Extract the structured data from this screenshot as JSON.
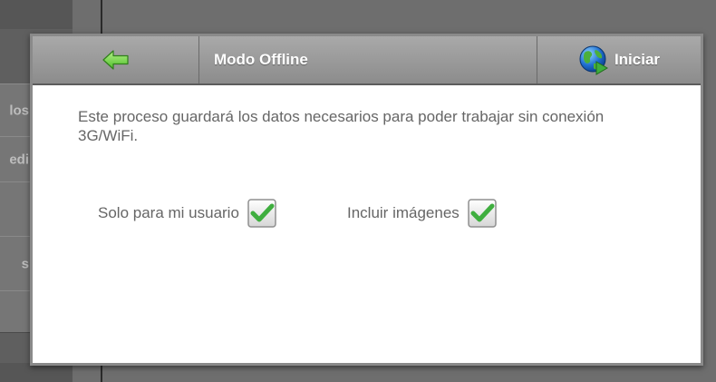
{
  "background": {
    "tabs": [
      {
        "label": "los"
      },
      {
        "label": "edi"
      },
      {
        "label": ""
      },
      {
        "label": "s"
      },
      {
        "label": ""
      }
    ]
  },
  "dialog": {
    "title": "Modo Offline",
    "back_icon": "arrow-left-icon",
    "start_label": "Iniciar",
    "start_icon": "globe-icon",
    "description": "Este proceso guardará los datos necesarios para poder trabajar sin conexión 3G/WiFi.",
    "options": [
      {
        "label": "Solo para mi usuario",
        "checked": true
      },
      {
        "label": "Incluir imágenes",
        "checked": true
      }
    ]
  },
  "colors": {
    "header": "#999999",
    "checkmark": "#3fae3f",
    "back_arrow": "#7ed957"
  }
}
